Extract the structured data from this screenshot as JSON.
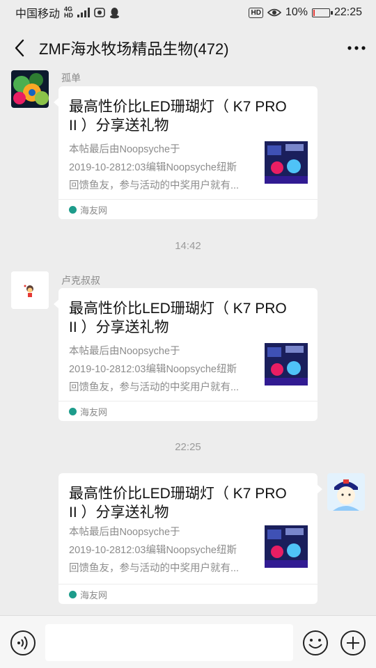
{
  "status_bar": {
    "carrier": "中国移动",
    "network_top": "4G",
    "network_bottom": "HD",
    "hd_label": "HD",
    "battery_percent": "10%",
    "battery_level": 0.1,
    "battery_color": "#e53935",
    "time": "22:25"
  },
  "header": {
    "title": "ZMF海水牧场精品生物(472)",
    "back_icon": "chevron-left-icon",
    "more_icon": "more-dots-icon"
  },
  "messages": [
    {
      "sender": "孤单",
      "side": "left",
      "card": {
        "title": "最高性价比LED珊瑚灯（ K7 PRO II ）分享送礼物",
        "desc_lines": [
          "本帖最后由Noopsyche于",
          "2019-10-2812:03编辑Noopsyche纽斯",
          "回馈鱼友，参与活动的中奖用户就有..."
        ],
        "source": "海友网"
      }
    },
    {
      "sender": "卢克叔叔",
      "side": "left",
      "card": {
        "title": "最高性价比LED珊瑚灯（ K7 PRO II ）分享送礼物",
        "desc_lines": [
          "本帖最后由Noopsyche于",
          "2019-10-2812:03编辑Noopsyche纽斯",
          "回馈鱼友，参与活动的中奖用户就有..."
        ],
        "source": "海友网"
      }
    },
    {
      "sender": "",
      "side": "right",
      "card": {
        "title": "最高性价比LED珊瑚灯（ K7 PRO II ）分享送礼物",
        "desc_lines": [
          "本帖最后由Noopsyche于",
          "2019-10-2812:03编辑Noopsyche纽斯",
          "回馈鱼友，参与活动的中奖用户就有..."
        ],
        "source": "海友网"
      }
    }
  ],
  "timestamps": [
    "14:42",
    "22:25"
  ],
  "input_bar": {
    "voice_icon": "voice-icon",
    "emoji_icon": "emoji-icon",
    "plus_icon": "plus-icon"
  }
}
